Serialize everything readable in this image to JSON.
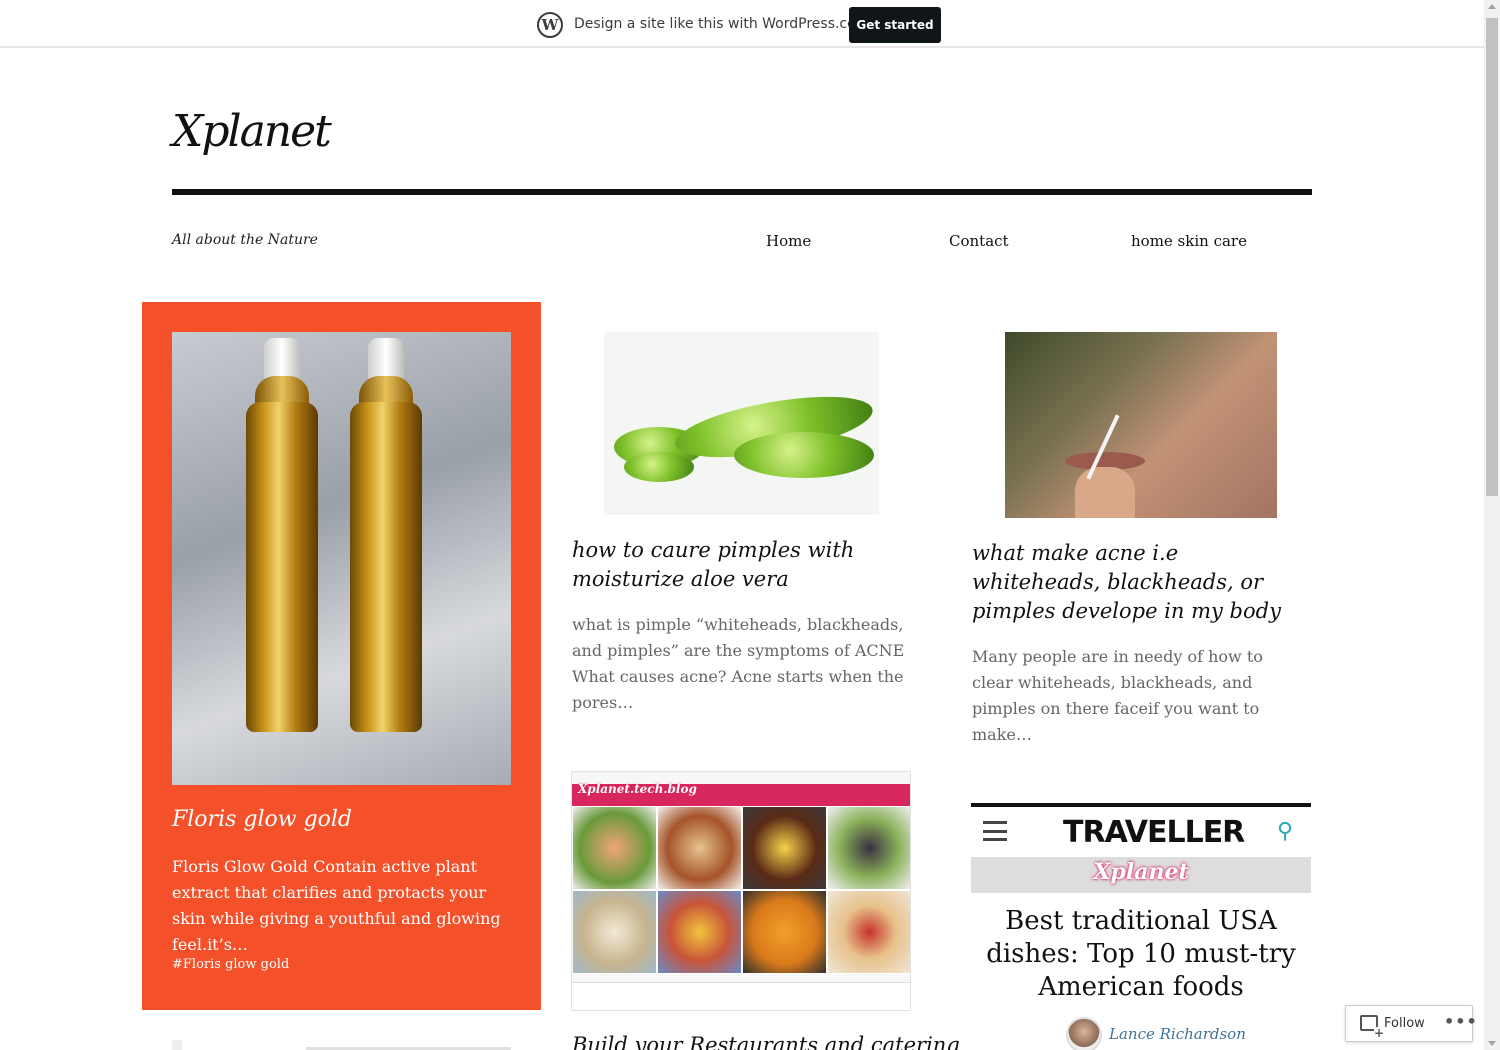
{
  "banner": {
    "logo": "W",
    "text": "Design a site like this with WordPress.com",
    "button": "Get started"
  },
  "site": {
    "title": "Xplanet",
    "tagline": "All about the Nature"
  },
  "nav": {
    "items": [
      "Home",
      "Contact",
      "home skin care"
    ]
  },
  "featured": {
    "title": "Floris glow gold",
    "excerpt": "Floris Glow Gold Contain active plant extract that clarifies and protacts your skin while giving a youthful and glowing feel.it’s…",
    "tag": "#Floris glow gold",
    "accent": "#f4502a"
  },
  "posts": [
    {
      "title": "how to caure pimples with moisturize aloe vera",
      "excerpt": "what is pimple “whiteheads, blackheads, and pimples” are the symptoms of ACNE What causes acne? Acne starts when the pores…"
    },
    {
      "title": "what make acne i.e whiteheads, blackheads, or pimples develope in my body",
      "excerpt": "Many people are in needy of how to clear whiteheads, blackheads, and pimples on there faceif you want to make…"
    },
    {
      "title": "Build your Restaurants and catering",
      "image_brand": "Xplanet.tech.blog"
    }
  ],
  "traveller": {
    "name": "TRAVELLER",
    "brand": "Xplanet",
    "headline": "Best traditional USA dishes: Top 10 must-try American foods",
    "author": "Lance Richardson"
  },
  "follow": {
    "label": "Follow",
    "more": "•••"
  },
  "icons": {
    "wordpress": "wordpress-logo-icon",
    "menu": "hamburger-menu-icon",
    "search": "search-icon",
    "follow": "reader-follow-icon",
    "more": "more-dots-icon"
  }
}
